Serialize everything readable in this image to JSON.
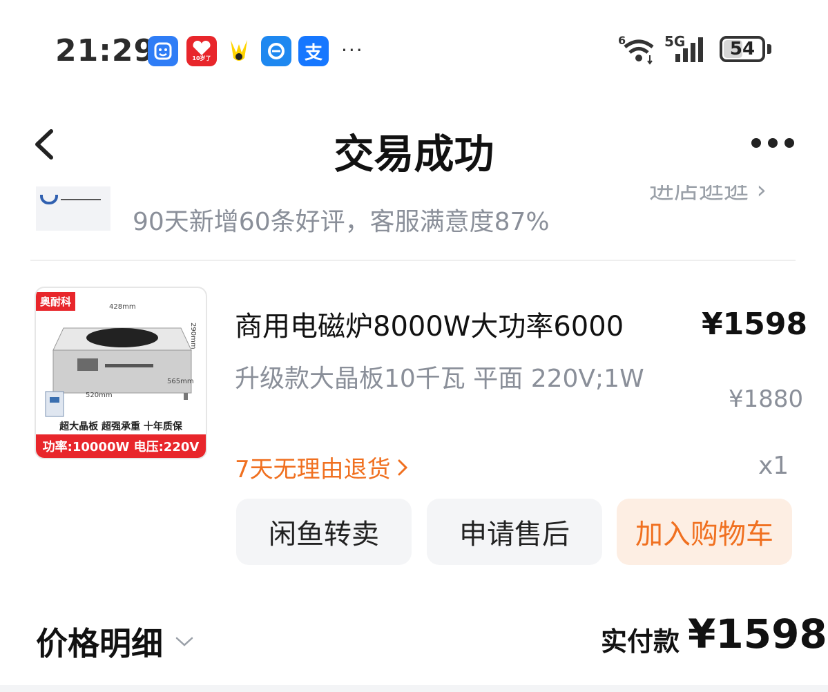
{
  "status_bar": {
    "time": "21:29",
    "app_icons": [
      {
        "icon": "face-app-icon",
        "color": "#2f7df6"
      },
      {
        "icon": "tmall-heart-icon",
        "color": "#e8262b",
        "caption": "10岁了"
      },
      {
        "icon": "meituan-icon",
        "color": "#ffd400"
      },
      {
        "icon": "eleme-icon",
        "color": "#1e88f0"
      },
      {
        "icon": "alipay-icon",
        "color": "#1677ff",
        "glyph": "支"
      }
    ],
    "more": "···",
    "wifi_badge": "6",
    "network": "5G",
    "battery": 54
  },
  "nav": {
    "title": "交易成功"
  },
  "shop": {
    "stat": "90天新增60条好评，客服满意度87%",
    "link_partial": "进店逛逛 ›"
  },
  "product": {
    "image": {
      "brand_tag": "奥耐科",
      "dims": [
        "428mm",
        "290mm",
        "565mm",
        "520mm"
      ],
      "features": "超大晶板  超强承重  十年质保",
      "promo": "功率:10000W  电压:220V"
    },
    "title": "商用电磁炉8000W大功率6000",
    "price": "¥1598",
    "spec": "升级款大晶板10千瓦 平面 220V;1W",
    "original_price": "¥1880",
    "return_policy": "7天无理由退货",
    "quantity": "x1"
  },
  "actions": {
    "resell": "闲鱼转卖",
    "after_sale": "申请售后",
    "add_to_cart": "加入购物车"
  },
  "summary": {
    "price_detail": "价格明细",
    "paid_label": "实付款",
    "paid_amount": "¥1598"
  },
  "colors": {
    "accent_orange": "#f07020",
    "promo_red": "#e8262b",
    "muted_text": "#8a8f99"
  }
}
